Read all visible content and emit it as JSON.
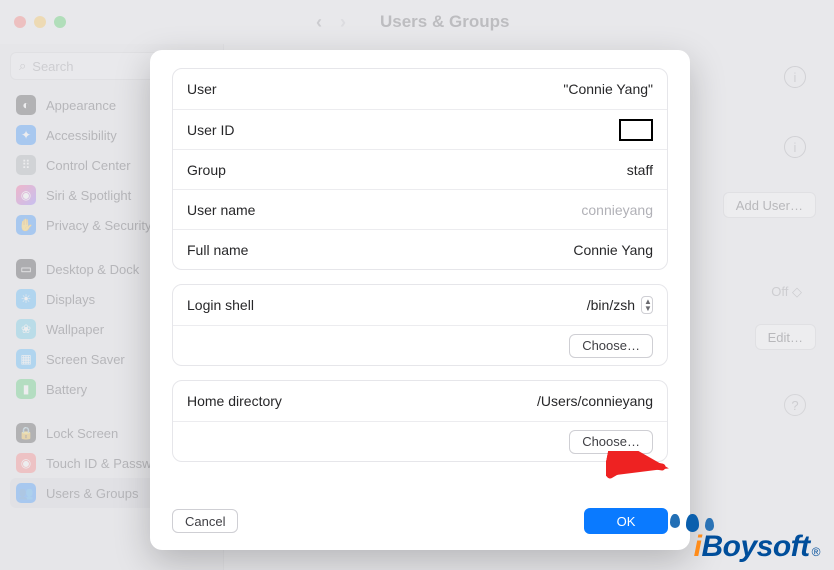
{
  "titlebar": {
    "section": "Users & Groups"
  },
  "search_placeholder": "Search",
  "sidebar": {
    "items": [
      {
        "label": "Appearance",
        "bg": "#2c2c2e",
        "glyph": "◐"
      },
      {
        "label": "Accessibility",
        "bg": "#0a7aff",
        "glyph": "✦"
      },
      {
        "label": "Control Center",
        "bg": "#9aa0a6",
        "glyph": "⠿"
      },
      {
        "label": "Siri & Spotlight",
        "bg": "linear-gradient(135deg,#ff3b7b,#7a5cff)",
        "glyph": "◉"
      },
      {
        "label": "Privacy & Security",
        "bg": "#0a7aff",
        "glyph": "✋"
      }
    ],
    "items2": [
      {
        "label": "Desktop & Dock",
        "bg": "#1b1b1d",
        "glyph": "▭"
      },
      {
        "label": "Displays",
        "bg": "#2aa9ff",
        "glyph": "☀"
      },
      {
        "label": "Wallpaper",
        "bg": "#49c3e6",
        "glyph": "❀"
      },
      {
        "label": "Screen Saver",
        "bg": "#2aa9ff",
        "glyph": "▦"
      },
      {
        "label": "Battery",
        "bg": "#34c759",
        "glyph": "▮"
      }
    ],
    "items3": [
      {
        "label": "Lock Screen",
        "bg": "#2c2c2e",
        "glyph": "🔒"
      },
      {
        "label": "Touch ID & Password",
        "bg": "#ff6566",
        "glyph": "◉"
      },
      {
        "label": "Users & Groups",
        "bg": "#0a7aff",
        "glyph": "👥",
        "active": true
      }
    ]
  },
  "content": {
    "add_user_label": "Add User…",
    "off_label": "Off ◇",
    "edit_label": "Edit…"
  },
  "modal": {
    "rows1": {
      "user_label": "User",
      "user_value": "\"Connie Yang\"",
      "uid_label": "User ID",
      "group_label": "Group",
      "group_value": "staff",
      "uname_label": "User name",
      "uname_value": "connieyang",
      "full_label": "Full name",
      "full_value": "Connie Yang"
    },
    "rows2": {
      "shell_label": "Login shell",
      "shell_value": "/bin/zsh",
      "choose1": "Choose…"
    },
    "rows3": {
      "home_label": "Home directory",
      "home_value": "/Users/connieyang",
      "choose2": "Choose…"
    },
    "cancel": "Cancel",
    "ok": "OK"
  },
  "watermark": "iBoysoft"
}
